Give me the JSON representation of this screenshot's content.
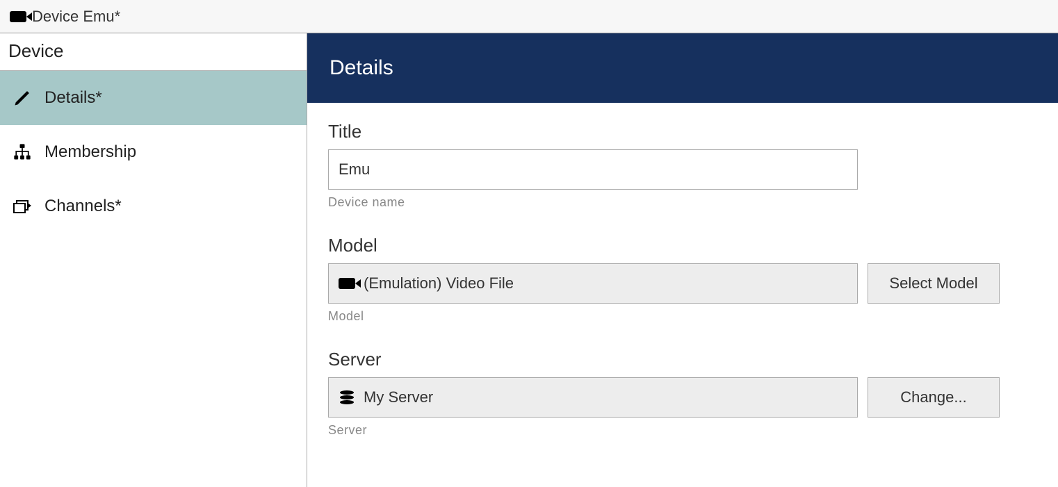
{
  "titlebar": {
    "text": "Device Emu*"
  },
  "sidebar": {
    "heading": "Device",
    "items": [
      {
        "label": "Details*",
        "active": true
      },
      {
        "label": "Membership",
        "active": false
      },
      {
        "label": "Channels*",
        "active": false
      }
    ]
  },
  "main": {
    "header": "Details",
    "fields": {
      "title": {
        "label": "Title",
        "value": "Emu",
        "help": "Device name"
      },
      "model": {
        "label": "Model",
        "value": "(Emulation) Video File",
        "button": "Select Model",
        "help": "Model"
      },
      "server": {
        "label": "Server",
        "value": "My Server",
        "button": "Change...",
        "help": "Server"
      }
    }
  }
}
